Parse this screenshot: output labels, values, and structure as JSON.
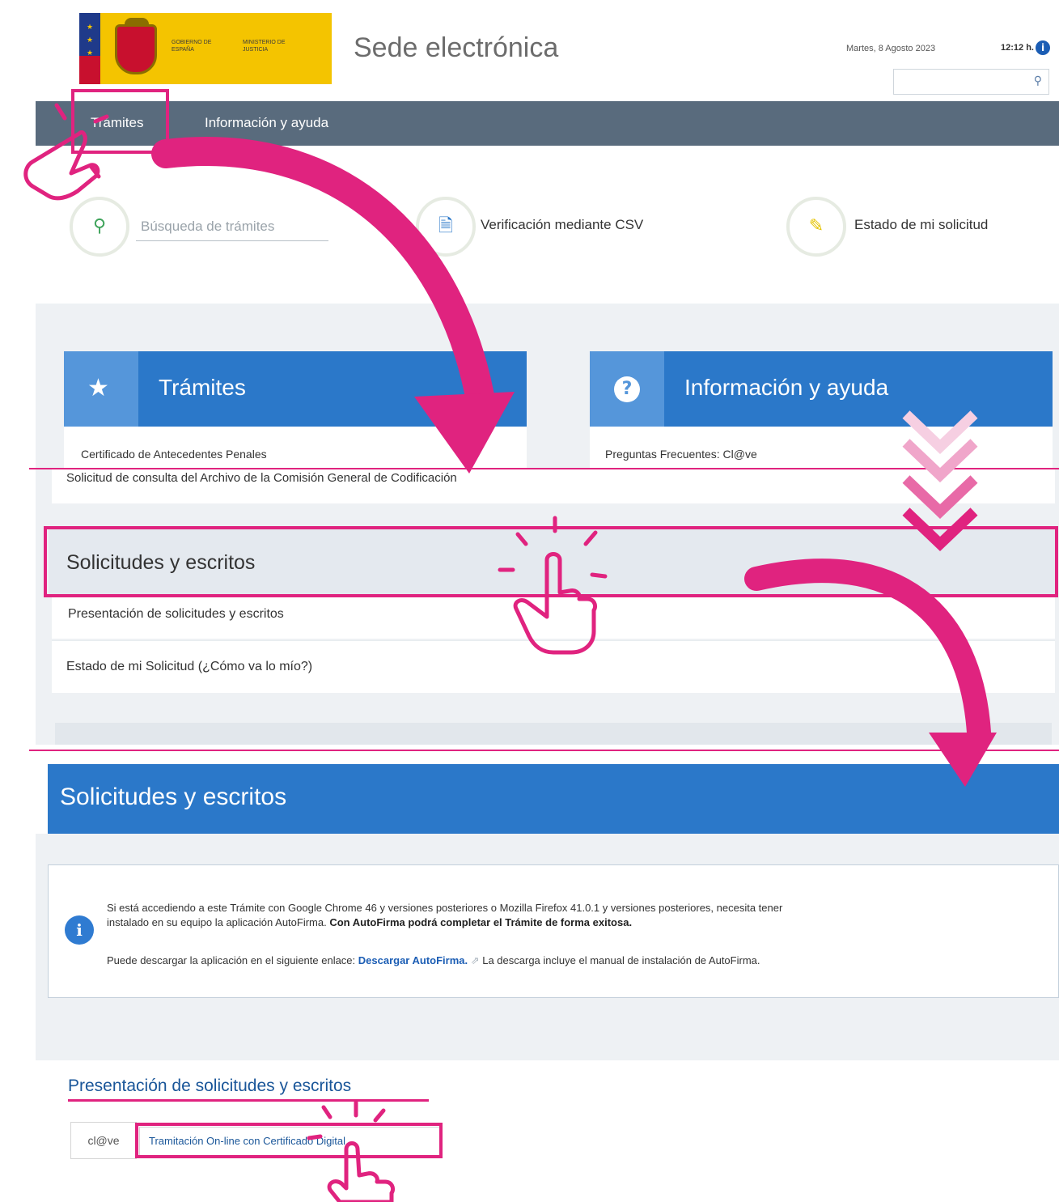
{
  "header": {
    "gov_label": "GOBIERNO DE ESPAÑA",
    "ministry_label": "MINISTERIO DE JUSTICIA",
    "site_title": "Sede electrónica",
    "date": "Martes, 8 Agosto 2023",
    "time": "12:12 h."
  },
  "nav": {
    "items": [
      {
        "label": "Trámites"
      },
      {
        "label": "Información y ayuda"
      }
    ]
  },
  "quick": {
    "search_placeholder": "Búsqueda de trámites",
    "csv_label": "Verificación mediante CSV",
    "status_label": "Estado de mi solicitud"
  },
  "panels": {
    "tramites": {
      "title": "Trámites",
      "first_link": "Certificado de Antecedentes Penales"
    },
    "info": {
      "title": "Información y ayuda",
      "first_link": "Preguntas Frecuentes: Cl@ve"
    }
  },
  "list1": {
    "consulta": "Solicitud de consulta del Archivo de la Comisión General de Codificación",
    "section_title": "Solicitudes y escritos",
    "item1": "Presentación de solicitudes y escritos",
    "item2": "Estado de mi Solicitud (¿Cómo va lo mío?)"
  },
  "detail": {
    "banner_title": "Solicitudes y escritos",
    "notice_p1": "Si está accediendo a este Trámite con Google Chrome 46 y versiones posteriores o Mozilla Firefox 41.0.1 y versiones posteriores, necesita tener",
    "notice_p1b": "instalado en su equipo la aplicación AutoFirma. ",
    "notice_p1_strong": "Con AutoFirma podrá completar el Trámite de forma exitosa.",
    "notice_p2a": "Puede descargar la aplicación en el siguiente enlace: ",
    "notice_p2_link": "Descargar AutoFirma.",
    "notice_p2b": " La descarga incluye el manual de instalación de AutoFirma.",
    "presentation_title": "Presentación de solicitudes y escritos",
    "clave_logo": "cl@ve",
    "online_link": "Tramitación On-line con Certificado Digital"
  },
  "colors": {
    "accent_pink": "#e0237f",
    "nav_bar": "#596b7d",
    "panel_blue": "#2b78c9",
    "logo_yellow": "#f4c400"
  },
  "icons": [
    "search-icon",
    "info-icon",
    "star-icon",
    "question-icon",
    "pencil-icon",
    "document-icon",
    "hand-pointer-icon",
    "chevron-down-icon",
    "arrow-icon"
  ]
}
